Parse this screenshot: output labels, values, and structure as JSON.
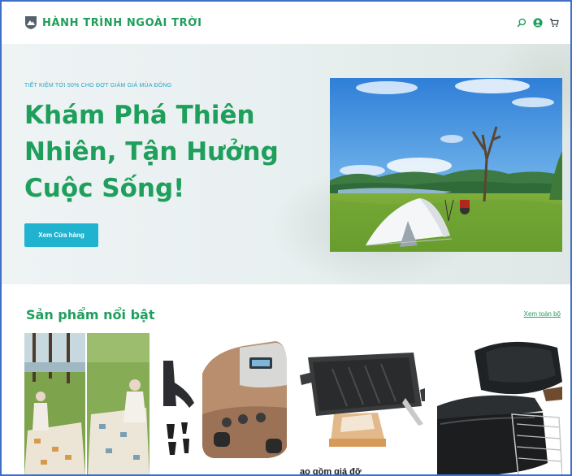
{
  "header": {
    "brand": "HÀNH TRÌNH NGOÀI TRỜI",
    "icons": [
      "search-icon",
      "user-account-icon",
      "cart-icon"
    ]
  },
  "hero": {
    "promo": "TIẾT KIỆM TỚI 50% CHO ĐỢT GIẢM GIÁ MÙA ĐÔNG",
    "title_lines": [
      "Khám Phá Thiên",
      "Nhiên, Tận Hưởng",
      "Cuộc Sống!"
    ],
    "cta": "Xem Cửa hàng"
  },
  "featured": {
    "title": "Sản phẩm nổi bật",
    "see_all": "Xem toàn bộ",
    "products": [
      {
        "image": "picnic-mat-photo"
      },
      {
        "image": "air-pump-photo"
      },
      {
        "image": "grill-pan-photo",
        "caption": "ao gồm giá đỡ"
      },
      {
        "image": "dutch-oven-photo"
      }
    ]
  },
  "colors": {
    "brand_green": "#1f9f5c",
    "accent_cyan": "#1fb3cf",
    "frame_blue": "#3f6fc6"
  }
}
